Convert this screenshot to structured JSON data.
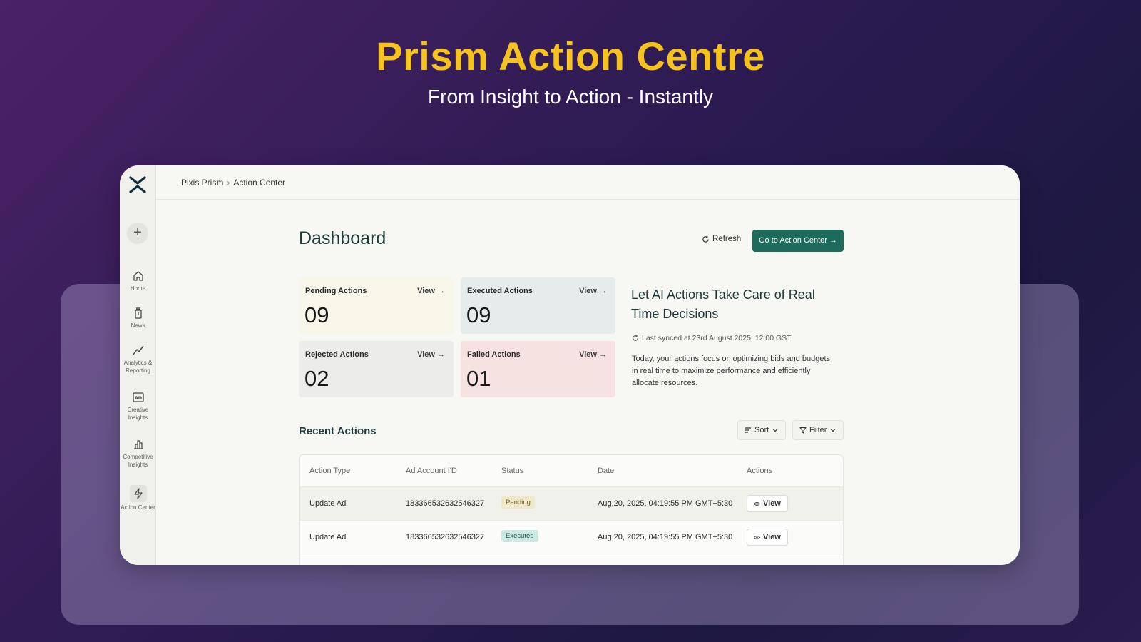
{
  "hero": {
    "title": "Prism Action Centre",
    "subtitle": "From Insight to Action - Instantly"
  },
  "colors": {
    "accent": "#f7c21c",
    "primary_button": "#1d6b5c"
  },
  "sidebar": {
    "items": [
      {
        "label": "Home",
        "icon": "home-icon"
      },
      {
        "label": "News",
        "icon": "news-icon"
      },
      {
        "label": "Analytics & Reporting",
        "icon": "analytics-icon"
      },
      {
        "label": "Creative Insights",
        "icon": "ad-icon"
      },
      {
        "label": "Competitive Insights",
        "icon": "bar-chart-icon"
      },
      {
        "label": "Action Center",
        "icon": "lightning-icon"
      }
    ]
  },
  "breadcrumb": {
    "root": "Pixis Prism",
    "separator": "›",
    "current": "Action Center"
  },
  "dashboard": {
    "title": "Dashboard",
    "refresh_label": "Refresh",
    "go_label": "Go to Action Center →"
  },
  "cards": {
    "pending": {
      "title": "Pending Actions",
      "view": "View →",
      "value": "09"
    },
    "executed": {
      "title": "Executed Actions",
      "view": "View →",
      "value": "09"
    },
    "rejected": {
      "title": "Rejected Actions",
      "view": "View →",
      "value": "02"
    },
    "failed": {
      "title": "Failed Actions",
      "view": "View →",
      "value": "01"
    }
  },
  "ai_panel": {
    "title": "Let AI Actions Take Care of Real Time Decisions",
    "synced": "Last synced at 23rd August 2025; 12:00 GST",
    "description": "Today, your actions focus on optimizing bids and budgets in real time to maximize performance and efficiently allocate resources."
  },
  "recent": {
    "title": "Recent Actions",
    "sort_label": "Sort",
    "filter_label": "Filter",
    "columns": [
      "Action Type",
      "Ad Account I'D",
      "Status",
      "Date",
      "Actions"
    ],
    "rows": [
      {
        "action_type": "Update Ad",
        "account_id": "183366532632546327",
        "status": "Pending",
        "date": "Aug,20, 2025, 04:19:55 PM GMT+5:30",
        "action": "View"
      },
      {
        "action_type": "Update Ad",
        "account_id": "183366532632546327",
        "status": "Executed",
        "date": "Aug,20, 2025, 04:19:55 PM GMT+5:30",
        "action": "View"
      }
    ]
  }
}
